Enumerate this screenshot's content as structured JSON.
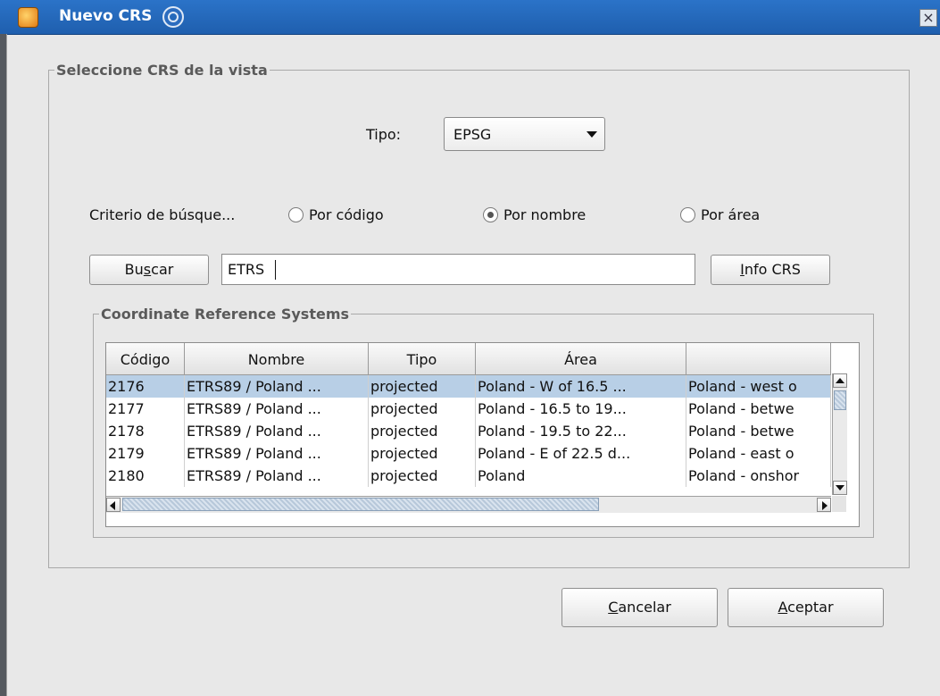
{
  "window": {
    "title": "Nuevo CRS",
    "close_glyph": "×"
  },
  "panel": {
    "legend": "Seleccione CRS de la vista",
    "tipo_label": "Tipo:",
    "tipo_value": "EPSG",
    "criterio_label": "Criterio de búsque...",
    "radios": [
      {
        "label": "Por código",
        "checked": false
      },
      {
        "label": "Por nombre",
        "checked": true
      },
      {
        "label": "Por área",
        "checked": false
      }
    ],
    "buscar_pre": "Bu",
    "buscar_mn": "s",
    "buscar_post": "car",
    "search_value": "ETRS",
    "info_mn": "I",
    "info_post": "nfo CRS"
  },
  "crs_table": {
    "legend": "Coordinate Reference Systems",
    "columns": [
      "Código",
      "Nombre",
      "Tipo",
      "Área",
      ""
    ],
    "rows": [
      [
        "2176",
        "ETRS89 / Poland ...",
        "projected",
        "Poland - W of 16.5 ...",
        "Poland - west o"
      ],
      [
        "2177",
        "ETRS89 / Poland ...",
        "projected",
        "Poland - 16.5 to 19...",
        "Poland - betwe"
      ],
      [
        "2178",
        "ETRS89 / Poland ...",
        "projected",
        "Poland - 19.5 to 22...",
        "Poland - betwe"
      ],
      [
        "2179",
        "ETRS89 / Poland ...",
        "projected",
        "Poland - E of 22.5 d...",
        "Poland - east o"
      ],
      [
        "2180",
        "ETRS89 / Poland ...",
        "projected",
        "Poland",
        "Poland - onshor"
      ]
    ],
    "selected_row": 0
  },
  "footer": {
    "cancel_mn": "C",
    "cancel_post": "ancelar",
    "accept_mn": "A",
    "accept_post": "ceptar"
  },
  "icons": [
    "app-icon",
    "window-swirl-icon",
    "close-icon",
    "chevron-down-icon",
    "scroll-up-icon",
    "scroll-down-icon",
    "scroll-left-icon",
    "scroll-right-icon"
  ],
  "colors": {
    "titlebar": "#1f5fae",
    "selection": "#b8cfe6"
  }
}
